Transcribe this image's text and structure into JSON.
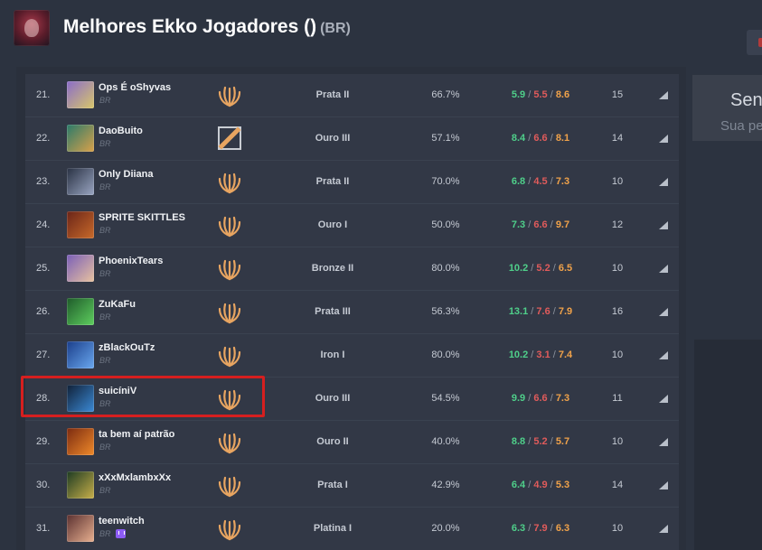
{
  "header": {
    "title": "Melhores Ekko Jogadores ()",
    "region": "(BR)"
  },
  "side": {
    "heading": "Sen",
    "sub": "Sua pe"
  },
  "colors": {
    "kills": "#4fcf8a",
    "deaths": "#e05b5b",
    "assists": "#f0a24a",
    "highlight": "#d61f1f"
  },
  "rows": [
    {
      "rank": "21.",
      "name": "Ops É oShyvas",
      "region": "BR",
      "rank_icon": "legendary-crest-icon",
      "tier": "Prata II",
      "winrate": "66.7%",
      "k": "5.9",
      "d": "5.5",
      "a": "8.6",
      "games": "15",
      "avatar": [
        "#8a6cc9",
        "#d9c76a"
      ]
    },
    {
      "rank": "22.",
      "name": "DaoBuito",
      "region": "BR",
      "rank_icon": "diagonal-slash-icon",
      "tier": "Ouro III",
      "winrate": "57.1%",
      "k": "8.4",
      "d": "6.6",
      "a": "8.1",
      "games": "14",
      "avatar": [
        "#2a7a6a",
        "#d9a14a"
      ]
    },
    {
      "rank": "23.",
      "name": "Only Diiana",
      "region": "BR",
      "rank_icon": "legendary-crest-icon",
      "tier": "Prata II",
      "winrate": "70.0%",
      "k": "6.8",
      "d": "4.5",
      "a": "7.3",
      "games": "10",
      "avatar": [
        "#283042",
        "#9aa6c2"
      ]
    },
    {
      "rank": "24.",
      "name": "SPRITE SKITTLES",
      "region": "BR",
      "rank_icon": "legendary-crest-icon",
      "tier": "Ouro I",
      "winrate": "50.0%",
      "k": "7.3",
      "d": "6.6",
      "a": "9.7",
      "games": "12",
      "avatar": [
        "#6a2418",
        "#c86a2a"
      ]
    },
    {
      "rank": "25.",
      "name": "PhoenixTears",
      "region": "BR",
      "rank_icon": "legendary-crest-icon",
      "tier": "Bronze II",
      "winrate": "80.0%",
      "k": "10.2",
      "d": "5.2",
      "a": "6.5",
      "games": "10",
      "avatar": [
        "#7a5fb8",
        "#e8c2a0"
      ]
    },
    {
      "rank": "26.",
      "name": "ZuKaFu",
      "region": "BR",
      "rank_icon": "legendary-crest-icon",
      "tier": "Prata III",
      "winrate": "56.3%",
      "k": "13.1",
      "d": "7.6",
      "a": "7.9",
      "games": "16",
      "avatar": [
        "#1e5a2a",
        "#5fd05f"
      ]
    },
    {
      "rank": "27.",
      "name": "zBlackOuTz",
      "region": "BR",
      "rank_icon": "legendary-crest-icon",
      "tier": "Iron I",
      "winrate": "80.0%",
      "k": "10.2",
      "d": "3.1",
      "a": "7.4",
      "games": "10",
      "avatar": [
        "#1a3e8a",
        "#6aa8f0"
      ]
    },
    {
      "rank": "28.",
      "name": "suicíniV",
      "region": "BR",
      "rank_icon": "legendary-crest-icon",
      "tier": "Ouro III",
      "winrate": "54.5%",
      "k": "9.9",
      "d": "6.6",
      "a": "7.3",
      "games": "11",
      "avatar": [
        "#102036",
        "#3b8ad6"
      ]
    },
    {
      "rank": "29.",
      "name": "ta bem aí patrão",
      "region": "BR",
      "rank_icon": "legendary-crest-icon",
      "tier": "Ouro II",
      "winrate": "40.0%",
      "k": "8.8",
      "d": "5.2",
      "a": "5.7",
      "games": "10",
      "avatar": [
        "#7a2a10",
        "#f08a2a"
      ]
    },
    {
      "rank": "30.",
      "name": "xXxMxlambxXx",
      "region": "BR",
      "rank_icon": "legendary-crest-icon",
      "tier": "Prata I",
      "winrate": "42.9%",
      "k": "6.4",
      "d": "4.9",
      "a": "5.3",
      "games": "14",
      "avatar": [
        "#1c3a22",
        "#c8b04a"
      ]
    },
    {
      "rank": "31.",
      "name": "teenwitch",
      "region": "BR",
      "rank_icon": "legendary-crest-icon",
      "tier": "Platina I",
      "winrate": "20.0%",
      "k": "6.3",
      "d": "7.9",
      "a": "6.3",
      "games": "10",
      "avatar": [
        "#5a3030",
        "#e8b090"
      ],
      "twitch": true
    }
  ]
}
